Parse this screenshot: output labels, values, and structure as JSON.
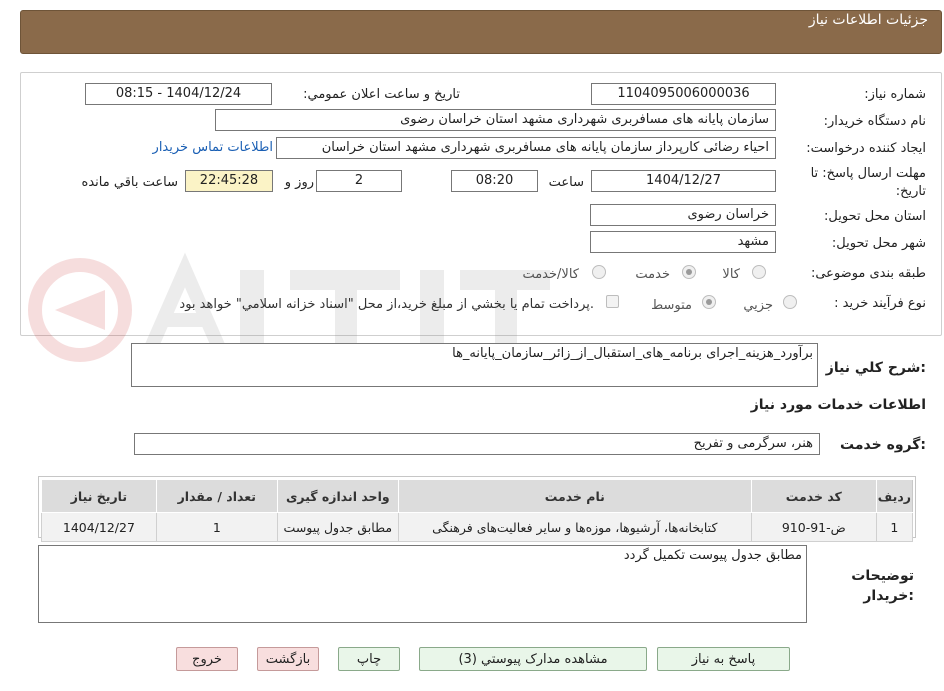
{
  "header": {
    "title": "جزئیات اطلاعات نیاز"
  },
  "form": {
    "need_number_label": "شماره نیاز:",
    "need_number": "1104095006000036",
    "announce_label": "تاریخ و ساعت اعلان عمومي:",
    "announce_value": "1404/12/24 - 08:15",
    "buyer_org_label": "نام دستگاه خريدار:",
    "buyer_org": "سازمان پایانه های مسافربری شهرداری مشهد استان خراسان رضوی",
    "requester_label": "ايجاد کننده درخواست:",
    "requester": "احیاء رضائی کارپرداز سازمان پایانه های مسافربری شهرداری مشهد استان خراسان",
    "contact_link": "اطلاعات تماس خريدار",
    "deadline_label": "مهلت ارسال پاسخ: تا تاريخ:",
    "deadline_date": "1404/12/27",
    "time_label": "ساعت",
    "deadline_time": "08:20",
    "days_value": "2",
    "days_label": "روز و",
    "remaining_time": "22:45:28",
    "remaining_label": "ساعت باقي مانده",
    "province_label": "استان محل تحويل:",
    "province": "خراسان رضوی",
    "city_label": "شهر محل تحويل:",
    "city": "مشهد",
    "category_label": "طبقه بندی موضوعی:",
    "category_options": [
      "کالا",
      "خدمت",
      "کالا/خدمت"
    ],
    "category_selected": "خدمت",
    "process_label": "نوع فرآيند خريد :",
    "process_options": [
      "جزيي",
      "متوسط"
    ],
    "process_selected": "متوسط",
    "payment_note": "پرداخت تمام يا بخشي از مبلغ خريد،از محل \"اسناد خزانه اسلامي\" خواهد بود.",
    "summary_label": "شرح کلي نياز:",
    "summary": "برآورد_هزینه_اجرای برنامه_های_استقبال_از_زائر_سازمان_پایانه_ها"
  },
  "services": {
    "section_title": "اطلاعات خدمات مورد نياز",
    "group_label": "گروه خدمت:",
    "group_value": "هنر، سرگرمی و تفریح",
    "columns": [
      "رديف",
      "کد خدمت",
      "نام خدمت",
      "واحد اندازه گيری",
      "تعداد / مقدار",
      "تاريخ نياز"
    ],
    "rows": [
      [
        "1",
        "ض-91-910",
        "کتابخانه‌ها، آرشیوها، موزه‌ها و سایر فعالیت‌های فرهنگی",
        "مطابق جدول پیوست",
        "1",
        "1404/12/27"
      ]
    ]
  },
  "notes": {
    "label": "توضيحات خريدار:",
    "value": "مطابق جدول پیوست تکمیل گردد"
  },
  "buttons": {
    "reply": "پاسخ به نياز",
    "docs": "مشاهده مدارک پيوستي (3)",
    "print": "چاپ",
    "back": "بازگشت",
    "exit": "خروج"
  },
  "colors": {
    "header": "#8a6a4a",
    "link": "#1a5fb4",
    "remaining_bg": "#fbf3c6",
    "button_green": "#e9f6e9",
    "button_red": "#f8dede"
  }
}
